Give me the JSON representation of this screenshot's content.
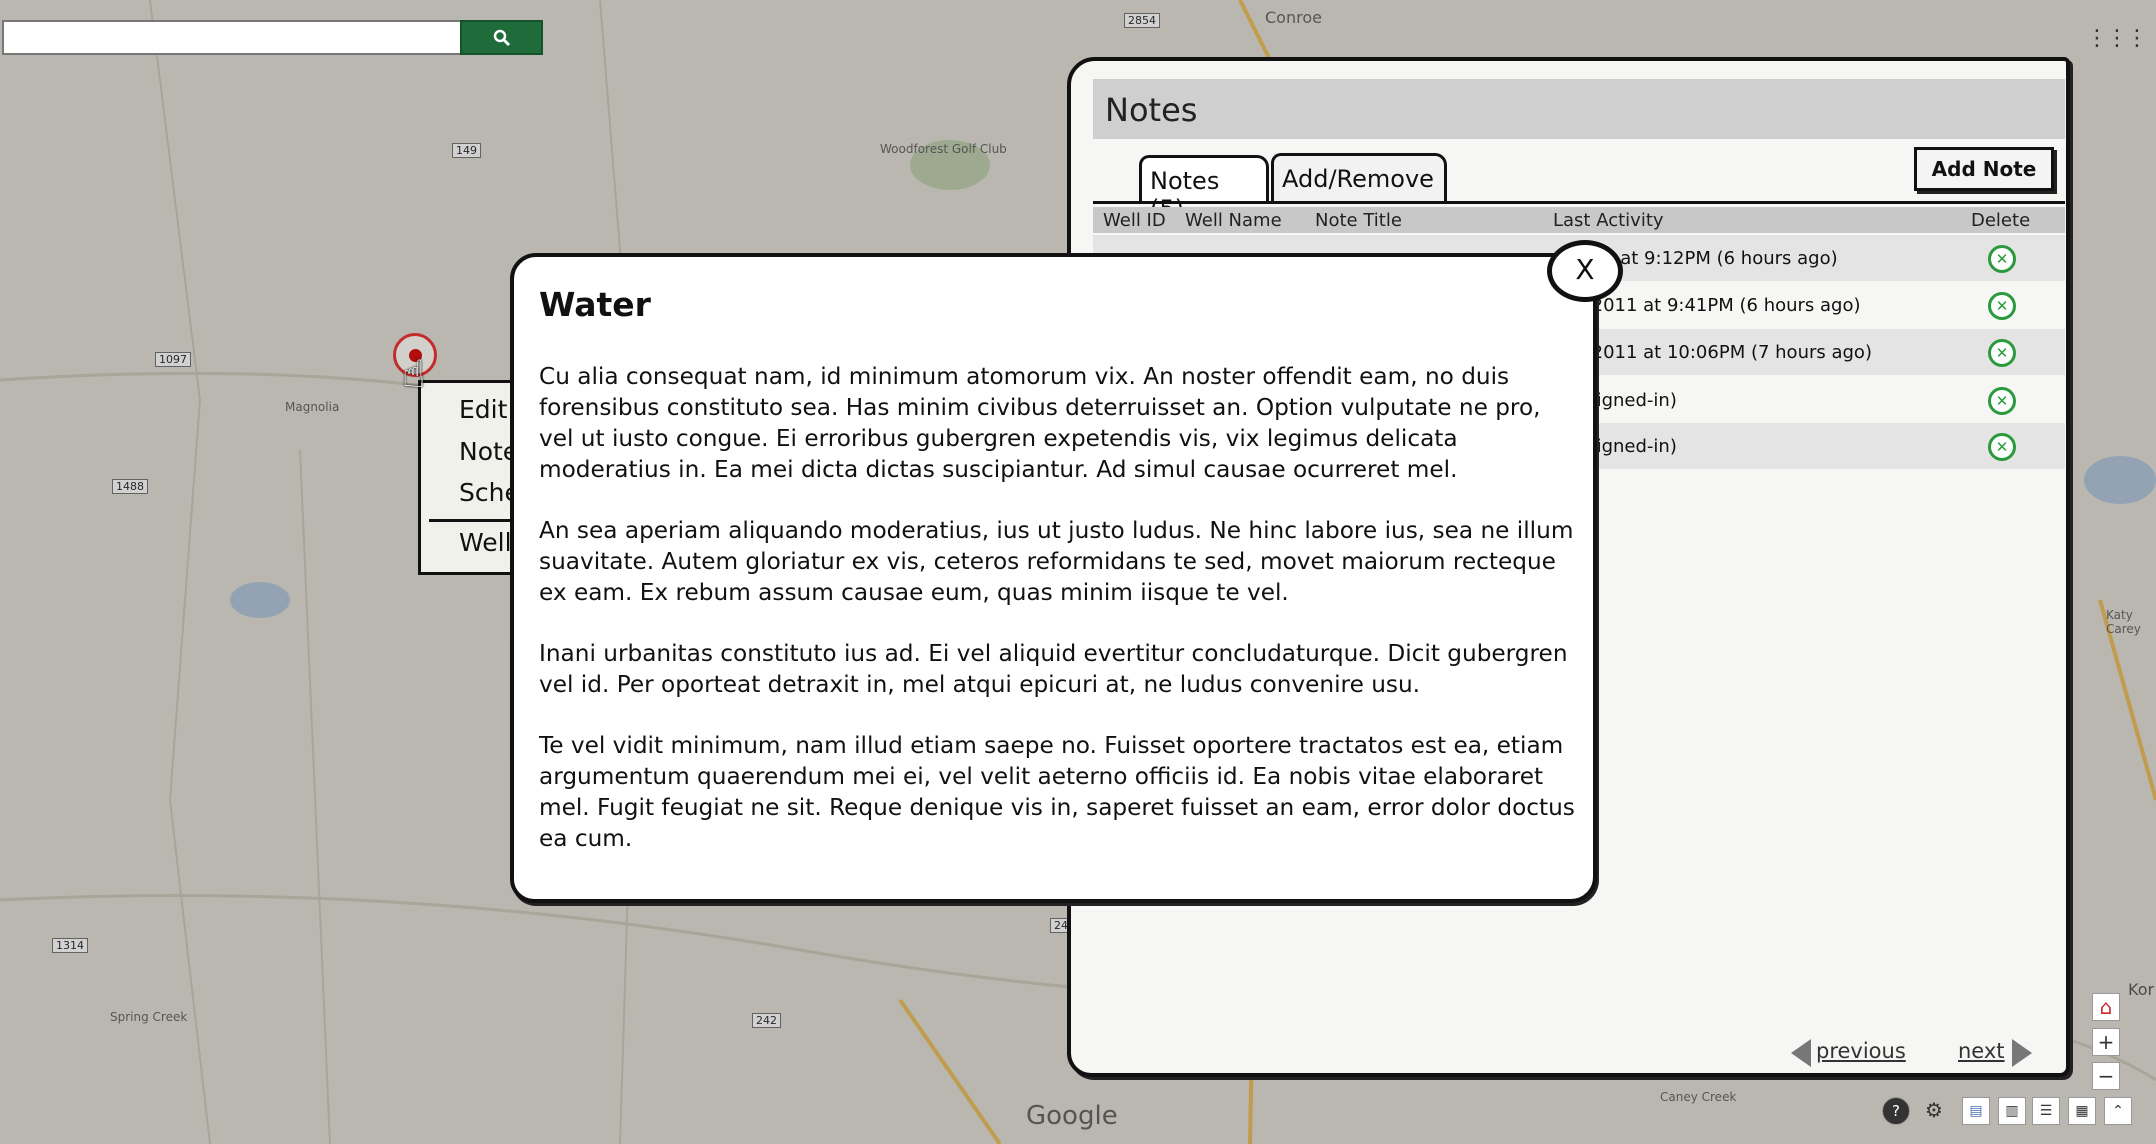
{
  "map": {
    "labels": [
      "Conroe",
      "Woodforest Golf Club",
      "Magnolia",
      "Google",
      "Kor",
      "Katy Carey",
      "Caney Creek",
      "Spring Creek"
    ],
    "highway_numbers": [
      "2854",
      "1488",
      "149",
      "242",
      "242",
      "249",
      "1097",
      "1314"
    ]
  },
  "search": {
    "placeholder": "",
    "button_icon": "search-icon"
  },
  "context_menu": {
    "items": [
      "Edit",
      "Note",
      "Sche",
      "Well"
    ]
  },
  "notes_panel": {
    "title": "Notes",
    "tabs": [
      "Notes (5)",
      "Add/Remove"
    ],
    "add_note_label": "Add Note",
    "columns": [
      "Well ID",
      "Well Name",
      "Note Title",
      "Last Activity",
      "Delete"
    ],
    "rows": [
      {
        "activity": ".2011 at 9:12PM (6 hours ago)"
      },
      {
        "activity": "21,2011 at 9:41PM (6 hours ago)"
      },
      {
        "activity": "21,2011 at 10:06PM (7 hours ago)"
      },
      {
        "activity": "er signed-in)"
      },
      {
        "activity": "er signed-in)"
      }
    ],
    "previous_label": "previous",
    "next_label": "next"
  },
  "modal": {
    "title": "Water",
    "close_label": "X",
    "paragraphs": [
      "Cu alia consequat nam, id minimum atomorum vix. An noster offendit eam, no duis forensibus constituto sea. Has minim civibus deterruisset an. Option vulputate ne pro, vel ut iusto congue. Ei erroribus gubergren expetendis vis, vix legimus delicata moderatius in. Ea mei dicta dictas suscipiantur. Ad simul causae ocurreret mel.",
      "An sea aperiam aliquando moderatius, ius ut justo ludus. Ne hinc labore ius, sea ne illum suavitate. Autem gloriatur ex vis, ceteros reformidans te sed, movet maiorum recteque ex eam. Ex rebum assum causae eum, quas minim iisque te vel.",
      "Inani urbanitas constituto ius ad. Ei vel aliquid evertitur concludaturque. Dicit gubergren vel id. Per oporteat detraxit in, mel atqui epicuri at, ne ludus convenire usu.",
      "Te vel vidit minimum, nam illud etiam saepe no. Fuisset oportere tractatos est ea, etiam argumentum quaerendum mei ei, vel velit aeterno officiis id. Ea nobis vitae elaboraret mel. Fugit feugiat ne sit. Reque denique vis in, saperet fuisset an eam, error dolor doctus ea cum."
    ]
  },
  "colors": {
    "accent": "#1f6b3a",
    "delete": "#2a9a3c",
    "marker": "#c42c2c"
  }
}
